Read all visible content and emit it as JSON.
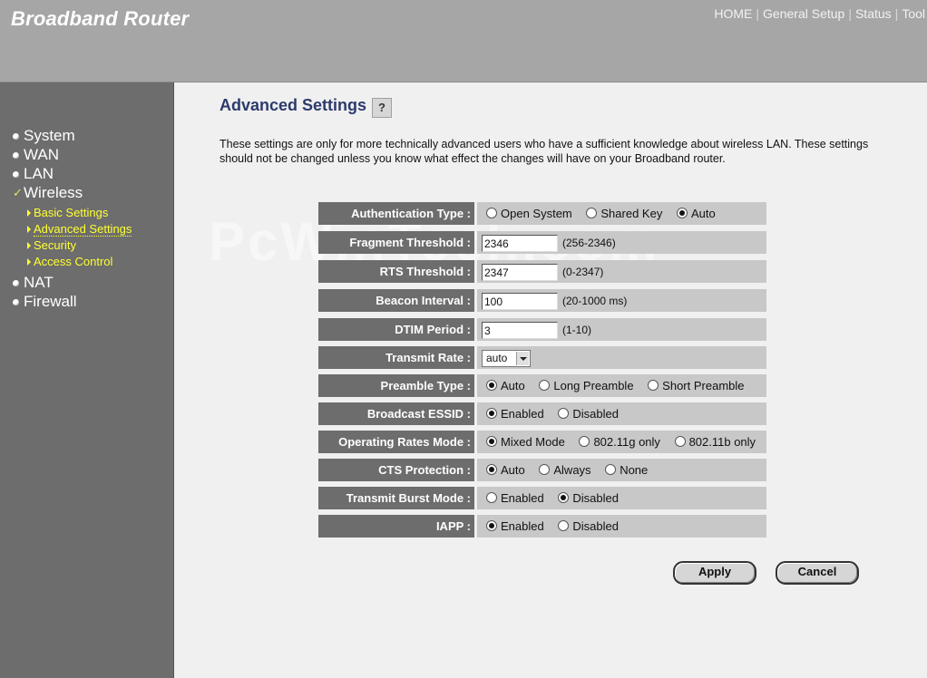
{
  "header": {
    "brand": "Broadband Router",
    "nav": [
      "HOME",
      "General Setup",
      "Status",
      "Tool"
    ]
  },
  "sidebar": {
    "items": [
      {
        "label": "System"
      },
      {
        "label": "WAN"
      },
      {
        "label": "LAN"
      },
      {
        "label": "Wireless"
      },
      {
        "label": "NAT"
      },
      {
        "label": "Firewall"
      }
    ],
    "wireless_sub": [
      {
        "label": "Basic Settings"
      },
      {
        "label": "Advanced Settings"
      },
      {
        "label": "Security"
      },
      {
        "label": "Access Control"
      }
    ]
  },
  "main": {
    "title": "Advanced Settings",
    "help_icon_char": "?",
    "description": "These settings are only for more technically advanced users who have a sufficient knowledge about wireless LAN. These settings should not be changed unless you know what effect the changes will have on your Broadband router.",
    "watermark": "PcWinTech.com"
  },
  "settings": {
    "auth": {
      "label": "Authentication Type :",
      "options": [
        "Open System",
        "Shared Key",
        "Auto"
      ],
      "selected": "Auto"
    },
    "frag": {
      "label": "Fragment Threshold :",
      "value": "2346",
      "range": "(256-2346)"
    },
    "rts": {
      "label": "RTS Threshold :",
      "value": "2347",
      "range": "(0-2347)"
    },
    "beacon": {
      "label": "Beacon Interval :",
      "value": "100",
      "range": "(20-1000 ms)"
    },
    "dtim": {
      "label": "DTIM Period :",
      "value": "3",
      "range": "(1-10)"
    },
    "rate": {
      "label": "Transmit Rate :",
      "value": "auto"
    },
    "preamble": {
      "label": "Preamble Type :",
      "options": [
        "Auto",
        "Long Preamble",
        "Short Preamble"
      ],
      "selected": "Auto"
    },
    "essid": {
      "label": "Broadcast ESSID :",
      "options": [
        "Enabled",
        "Disabled"
      ],
      "selected": "Enabled"
    },
    "oprates": {
      "label": "Operating Rates Mode :",
      "options": [
        "Mixed Mode",
        "802.11g only",
        "802.11b only"
      ],
      "selected": "Mixed Mode"
    },
    "cts": {
      "label": "CTS Protection :",
      "options": [
        "Auto",
        "Always",
        "None"
      ],
      "selected": "Auto"
    },
    "burst": {
      "label": "Transmit Burst Mode :",
      "options": [
        "Enabled",
        "Disabled"
      ],
      "selected": "Disabled"
    },
    "iapp": {
      "label": "IAPP :",
      "options": [
        "Enabled",
        "Disabled"
      ],
      "selected": "Enabled"
    }
  },
  "buttons": {
    "apply": "Apply",
    "cancel": "Cancel"
  }
}
